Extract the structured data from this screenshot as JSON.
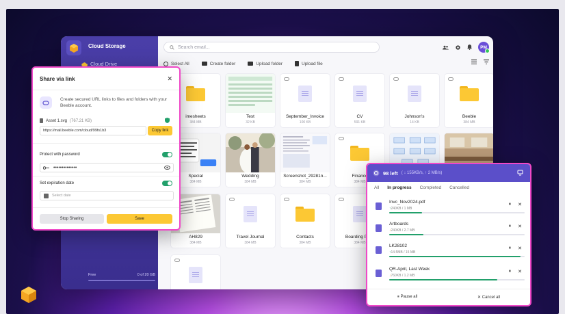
{
  "sidebar": {
    "title": "Cloud Storage",
    "items": [
      {
        "label": "Cloud Drive"
      }
    ],
    "storage_left": "Free",
    "storage_used": "0 of 20 GB"
  },
  "search": {
    "placeholder": "Search email..."
  },
  "user": {
    "initials": "PM"
  },
  "toolbar": {
    "select_all": "Select All",
    "create_folder": "Create folder",
    "upload_folder": "Upload folder",
    "upload_file": "Upload file"
  },
  "files": [
    {
      "name": "imesheets",
      "size": "384 MB",
      "kind": "folder"
    },
    {
      "name": "Test",
      "size": "32 KB",
      "kind": "sheet"
    },
    {
      "name": "September_Invoice",
      "size": "100 KB",
      "kind": "doc"
    },
    {
      "name": "CV",
      "size": "591 KB",
      "kind": "doc"
    },
    {
      "name": "Johnson's",
      "size": "14 KB",
      "kind": "doc"
    },
    {
      "name": "Beeble",
      "size": "384 MB",
      "kind": "folder"
    },
    {
      "name": "Special",
      "size": "384 MB",
      "kind": "chat"
    },
    {
      "name": "Wedding",
      "size": "384 MB",
      "kind": "photo"
    },
    {
      "name": "Screenshot_29281n...",
      "size": "384 MB",
      "kind": "screenshot"
    },
    {
      "name": "Finance",
      "size": "384 MB",
      "kind": "folder"
    },
    {
      "name": "",
      "size": "",
      "kind": "diagram"
    },
    {
      "name": "",
      "size": "",
      "kind": "photo2"
    },
    {
      "name": "AH829",
      "size": "384 MB",
      "kind": "paper"
    },
    {
      "name": "Travel Journal",
      "size": "384 MB",
      "kind": "doc"
    },
    {
      "name": "Contacts",
      "size": "384 MB",
      "kind": "folder"
    },
    {
      "name": "Boarding Pass",
      "size": "384 MB",
      "kind": "doc"
    },
    {
      "name": "",
      "size": "",
      "kind": "folder"
    },
    {
      "name": "",
      "size": "",
      "kind": "hex"
    },
    {
      "name": "",
      "size": "",
      "kind": "doc"
    }
  ],
  "share": {
    "title": "Share via link",
    "intro": "Create secured URL links to files and folders with your Beeble account.",
    "asset_name": "Asset 1.svg",
    "asset_size": "(767.21 KB)",
    "url": "https://mail.beeble.com/cloud/99fs1b3",
    "copy_label": "Copy link",
    "protect_label": "Protect with password",
    "password": "••••••••••••••",
    "expire_label": "Set expiration date",
    "date_placeholder": "Select date",
    "stop_label": "Stop Sharing",
    "save_label": "Save"
  },
  "transfers": {
    "count": "98 left",
    "speed": "( ↓ 155KB/s, ↑ 2 MB/s)",
    "tabs": [
      "All",
      "In progress",
      "Completed",
      "Cancelled"
    ],
    "items": [
      {
        "name": "Invc_Nov2024.pdf",
        "meta": "240KB / 1 MB",
        "dir": "up",
        "progress": 0.24
      },
      {
        "name": "Artboards",
        "meta": "240KB / 2.7 MB",
        "dir": "down",
        "progress": 0.25
      },
      {
        "name": "LK28102",
        "meta": "14.5MB / 15 MB",
        "dir": "up",
        "progress": 0.97
      },
      {
        "name": "QR-April, Last Week",
        "meta": "760KB / 1.2 MB",
        "dir": "down",
        "progress": 0.8
      }
    ],
    "pause_all": "Pause all",
    "cancel_all": "Cancel all"
  }
}
